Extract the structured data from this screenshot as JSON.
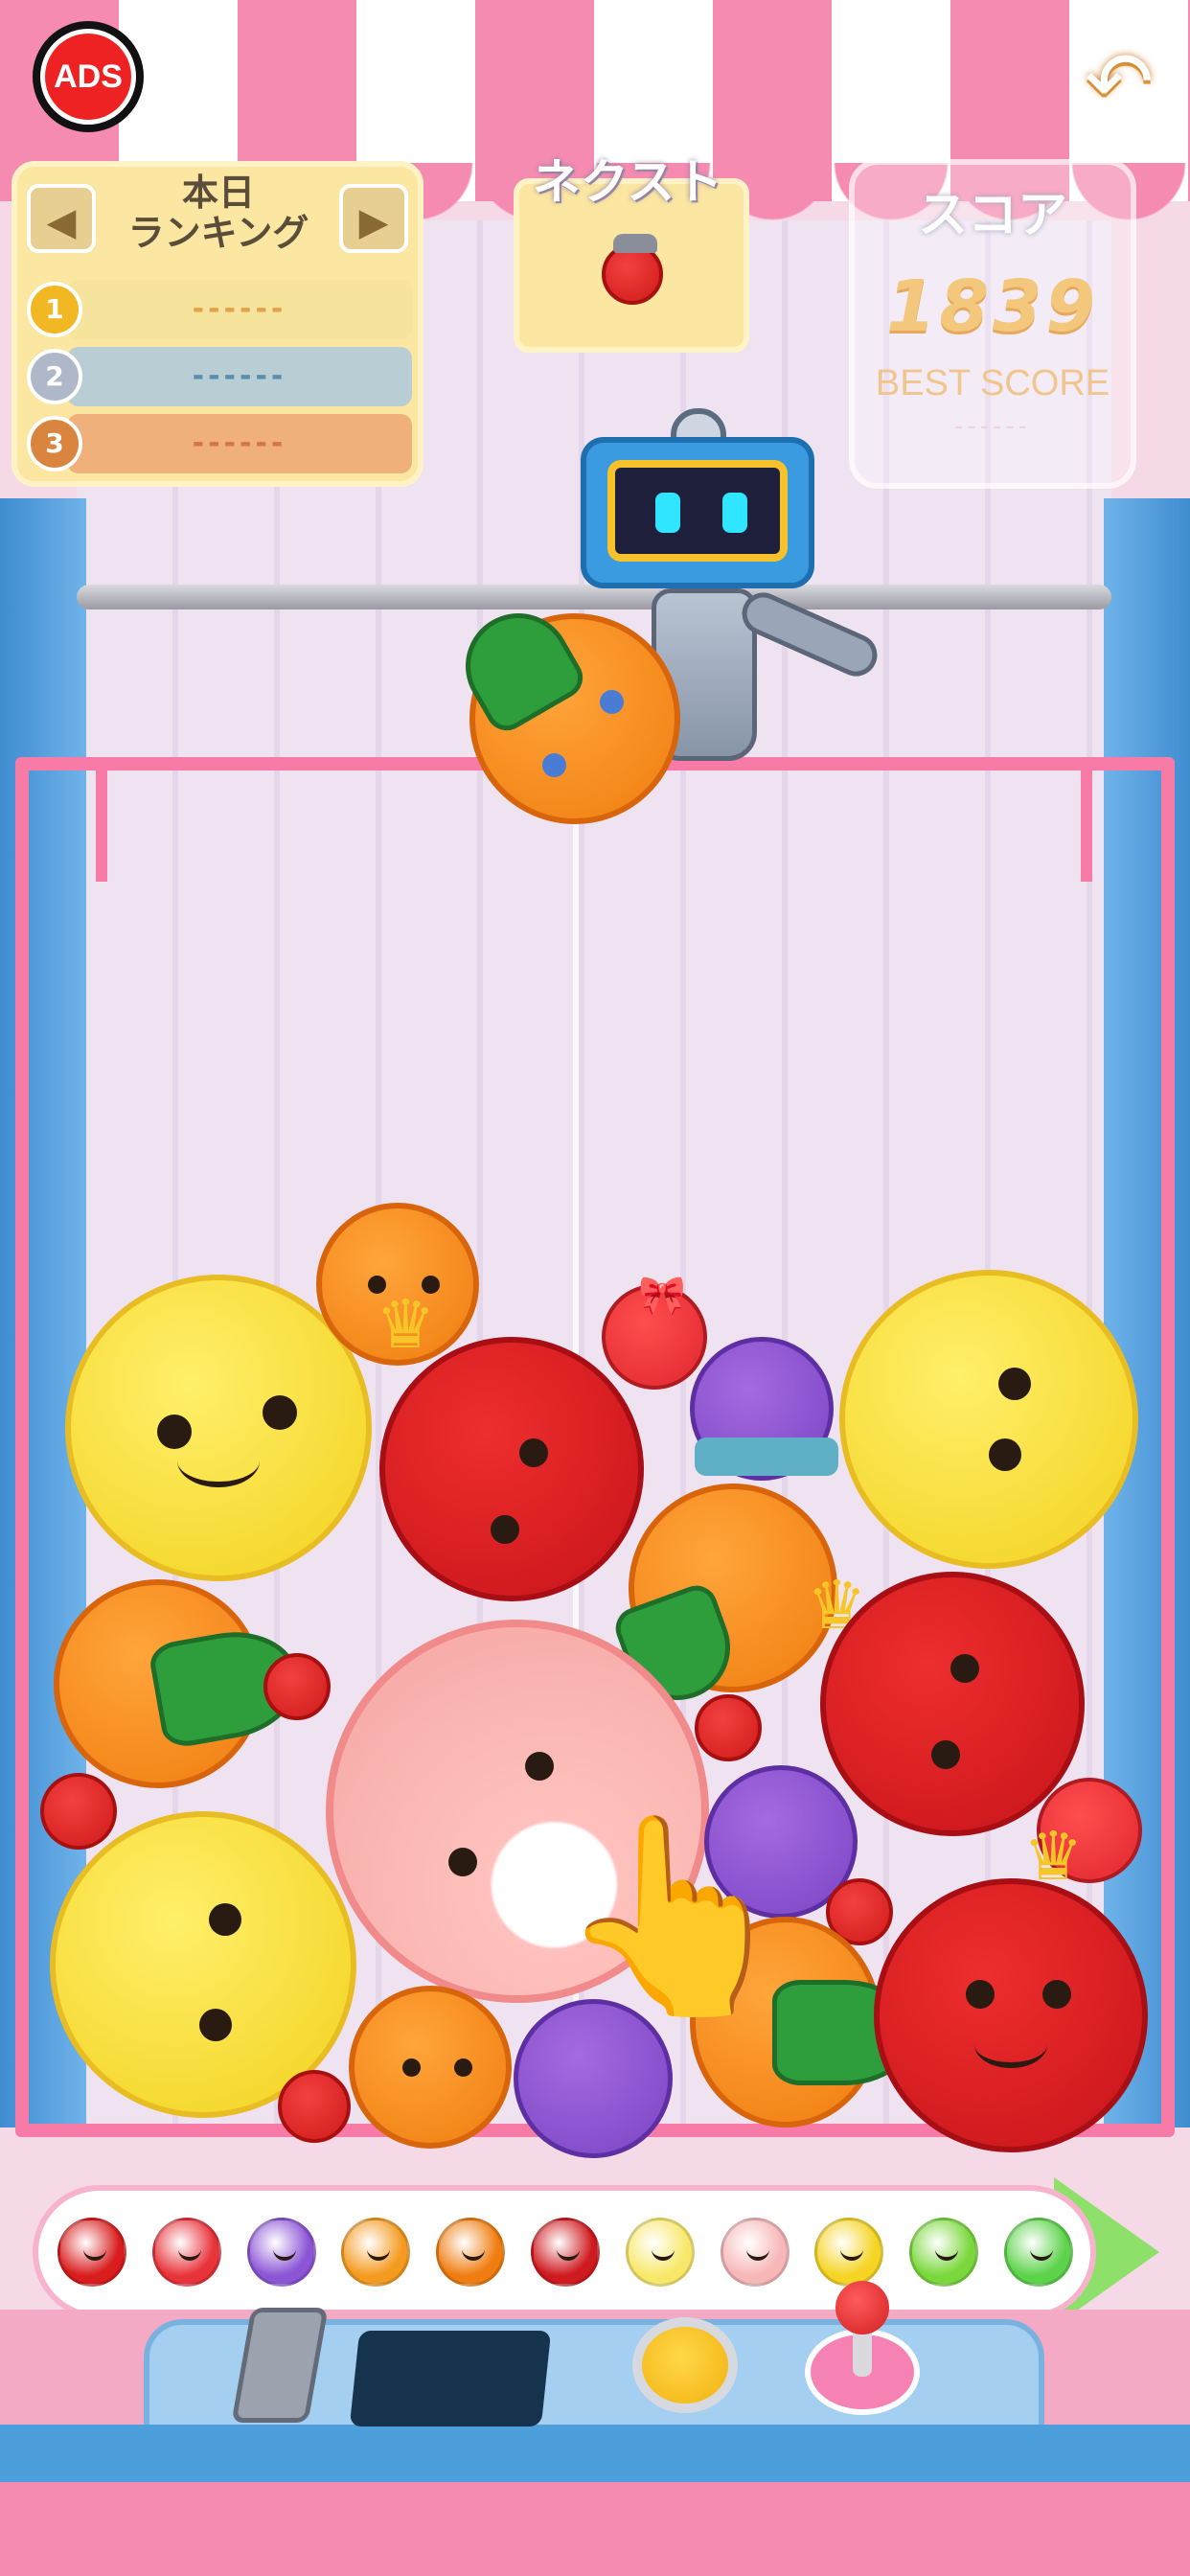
{
  "top_bar": {
    "ads_label": "ADS",
    "back_icon": "undo-arrow-icon"
  },
  "ranking": {
    "title_line1": "本日",
    "title_line2": "ランキング",
    "prev_icon": "chevron-left-icon",
    "next_icon": "chevron-right-icon",
    "entries": [
      {
        "rank": "1",
        "name": "------",
        "color": "#f6e39c",
        "text_color": "#e3a24a",
        "medal_color": "#f2b824"
      },
      {
        "rank": "2",
        "name": "------",
        "color": "#b9ced4",
        "text_color": "#5e8cab",
        "medal_color": "#aeb8c9"
      },
      {
        "rank": "3",
        "name": "------",
        "color": "#f0b07c",
        "text_color": "#d0764a",
        "medal_color": "#d9843f"
      }
    ]
  },
  "next": {
    "label": "ネクスト",
    "fruit": "cherry"
  },
  "score": {
    "label": "スコア",
    "value": "1839",
    "best_label": "BEST SCORE",
    "best_value": "------"
  },
  "evolution_bar": {
    "items": [
      "cherry",
      "strawberry",
      "grape",
      "dekopon",
      "persimmon",
      "apple",
      "pear",
      "peach",
      "pineapple",
      "melon",
      "watermelon"
    ],
    "colors": [
      "#d91c1c",
      "#e8333a",
      "#8c55d6",
      "#f59a20",
      "#f07d10",
      "#cf1a1f",
      "#f8e86a",
      "#f7b7b8",
      "#f5d423",
      "#7ad83c",
      "#5cd34a"
    ]
  },
  "colors": {
    "awning_pink": "#f58bb0",
    "cage_pink": "#f77aa7",
    "panel_blue": "#4d9fdc",
    "score_gold": "#f3c77c"
  }
}
